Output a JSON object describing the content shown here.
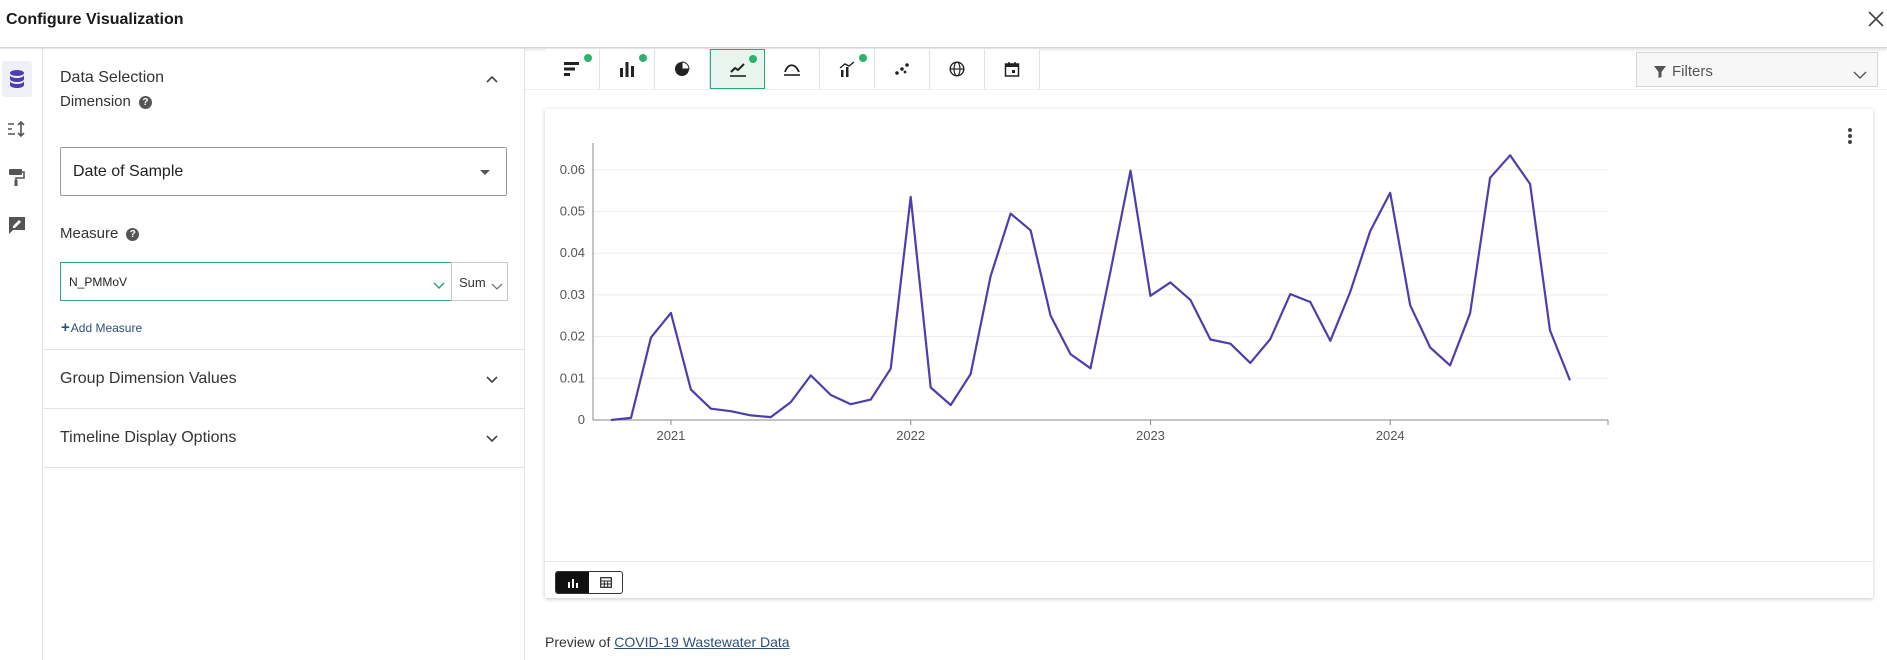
{
  "header": {
    "title": "Configure Visualization",
    "close_icon": "close-icon"
  },
  "rail": {
    "items": [
      "database-icon",
      "sort-icon",
      "paint-roller-icon",
      "edit-note-icon"
    ],
    "active": 0
  },
  "panel": {
    "data_selection": {
      "label": "Data Selection",
      "dimension_label": "Dimension",
      "dimension_value": "Date of Sample",
      "measure_label": "Measure",
      "measure_value": "N_PMMoV",
      "aggregation": "Sum",
      "add_measure": "Add Measure"
    },
    "group_dimension": "Group Dimension Values",
    "timeline_options": "Timeline Display Options"
  },
  "toolbar": {
    "items": [
      "horizontal-bar-chart-icon",
      "vertical-bar-chart-icon",
      "pie-chart-icon",
      "line-chart-icon",
      "area-curve-icon",
      "combo-chart-icon",
      "scatter-chart-icon",
      "map-globe-icon",
      "calendar-icon"
    ],
    "active": 3,
    "dots": [
      0,
      1,
      3,
      5
    ]
  },
  "filters": {
    "label": "Filters"
  },
  "accent_color": "#2aa87c",
  "line_color": "#4b3fae",
  "chart_data": {
    "type": "line",
    "title": "",
    "xlabel": "",
    "ylabel": "",
    "ylim": [
      0,
      0.065
    ],
    "yticks": [
      "0",
      "0.01",
      "0.02",
      "0.03",
      "0.04",
      "0.05",
      "0.06"
    ],
    "xticks": [
      "2021",
      "2022",
      "2023",
      "2024"
    ],
    "grid": true,
    "series": [
      {
        "x": [
          "2020-10",
          "2020-11",
          "2020-12",
          "2021-01",
          "2021-02",
          "2021-03",
          "2021-04",
          "2021-05",
          "2021-06",
          "2021-07",
          "2021-08",
          "2021-09",
          "2021-10",
          "2021-11",
          "2021-12",
          "2022-01",
          "2022-02",
          "2022-03",
          "2022-04",
          "2022-05",
          "2022-06",
          "2022-07",
          "2022-08",
          "2022-09",
          "2022-10",
          "2022-11",
          "2022-12",
          "2023-01",
          "2023-02",
          "2023-03",
          "2023-04",
          "2023-05",
          "2023-06",
          "2023-07",
          "2023-08",
          "2023-09",
          "2023-10",
          "2023-11",
          "2023-12",
          "2024-01",
          "2024-02",
          "2024-03",
          "2024-04",
          "2024-05",
          "2024-06",
          "2024-07",
          "2024-08",
          "2024-09",
          "2024-10",
          "2024-11"
        ],
        "values": [
          0.0,
          0.0005,
          0.0198,
          0.0257,
          0.0073,
          0.0027,
          0.0021,
          0.0011,
          0.0007,
          0.0043,
          0.0107,
          0.006,
          0.0038,
          0.0049,
          0.0123,
          0.0535,
          0.0078,
          0.0036,
          0.011,
          0.0345,
          0.0495,
          0.0455,
          0.025,
          0.0158,
          0.0124,
          0.0357,
          0.0598,
          0.0298,
          0.033,
          0.0288,
          0.0193,
          0.0183,
          0.0137,
          0.0194,
          0.0302,
          0.0283,
          0.019,
          0.0307,
          0.0453,
          0.0545,
          0.0275,
          0.0174,
          0.0131,
          0.0256,
          0.0581,
          0.0635,
          0.0566,
          0.0215,
          0.0095,
          null
        ]
      }
    ]
  },
  "preview": {
    "prefix": "Preview of",
    "link": "COVID-19 Wastewater Data"
  }
}
